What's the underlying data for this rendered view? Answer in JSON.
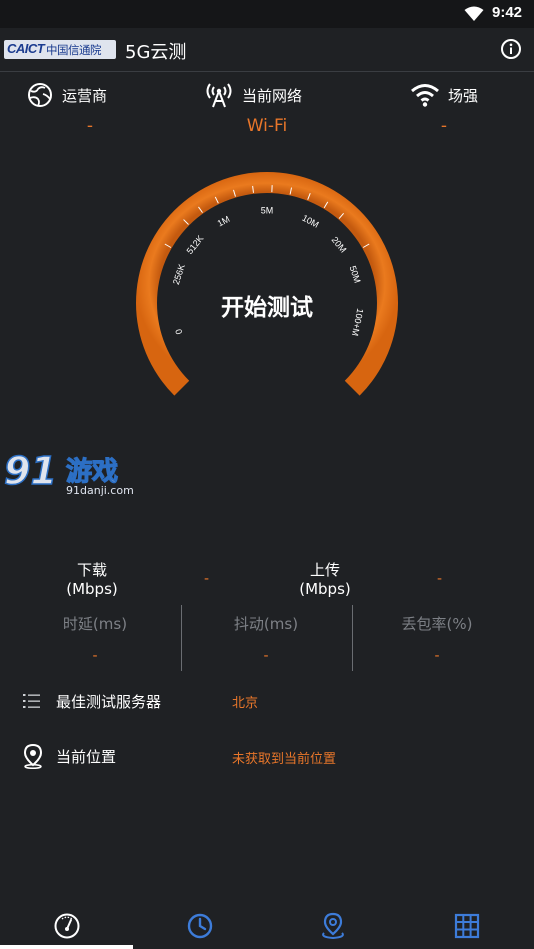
{
  "status": {
    "time": "9:42"
  },
  "header": {
    "logo_en": "CAICT",
    "logo_cn": "中国信通院",
    "title": "5G云测"
  },
  "network": {
    "operator_label": "运营商",
    "operator_value": "-",
    "network_label": "当前网络",
    "network_value": "Wi-Fi",
    "signal_label": "场强",
    "signal_value": "-"
  },
  "gauge": {
    "center_label": "开始测试",
    "scale_labels": [
      "0",
      "256K",
      "512K",
      "1M",
      "5M",
      "10M",
      "20M",
      "50M",
      "100+M"
    ]
  },
  "watermark": {
    "brand": "游戏",
    "digits": "91",
    "url": "91danji.com"
  },
  "stats": {
    "download_label": "下载",
    "download_unit": "(Mbps)",
    "download_value": "-",
    "upload_label": "上传",
    "upload_unit": "(Mbps)",
    "upload_value": "-",
    "latency_label": "时延(ms)",
    "latency_value": "-",
    "jitter_label": "抖动(ms)",
    "jitter_value": "-",
    "loss_label": "丢包率(%)",
    "loss_value": "-"
  },
  "info": {
    "server_label": "最佳测试服务器",
    "server_value": "北京",
    "location_label": "当前位置",
    "location_value": "未获取到当前位置"
  },
  "nav": {
    "icons": [
      "speedometer-icon",
      "clock-icon",
      "map-pin-icon",
      "table-icon"
    ],
    "active_index": 0
  },
  "colors": {
    "accent": "#e8762a",
    "background": "#1f2124",
    "muted": "#7d8086"
  }
}
